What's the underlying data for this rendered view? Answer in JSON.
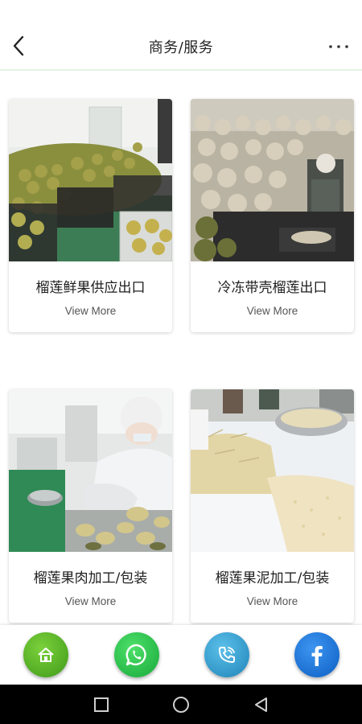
{
  "header": {
    "title": "商务/服务",
    "back_icon": "chevron-left-icon",
    "more_icon": "more-horizontal-icon"
  },
  "cards": [
    {
      "title": "榴莲鲜果供应出口",
      "link": "View More"
    },
    {
      "title": "冷冻带壳榴莲出口",
      "link": "View More"
    },
    {
      "title": "榴莲果肉加工/包装",
      "link": "View More"
    },
    {
      "title": "榴莲果泥加工/包装",
      "link": "View More"
    }
  ],
  "bottom_bar": {
    "items": [
      {
        "name": "home",
        "icon": "home-icon",
        "color": "#4caf1f"
      },
      {
        "name": "whatsapp",
        "icon": "whatsapp-icon",
        "color": "#1fbf3a"
      },
      {
        "name": "phone",
        "icon": "phone-icon",
        "color": "#2e9bd1"
      },
      {
        "name": "facebook",
        "icon": "facebook-icon",
        "color": "#1a74e0"
      }
    ]
  },
  "system_nav": {
    "items": [
      "recents-square-icon",
      "home-circle-icon",
      "back-triangle-icon"
    ]
  }
}
